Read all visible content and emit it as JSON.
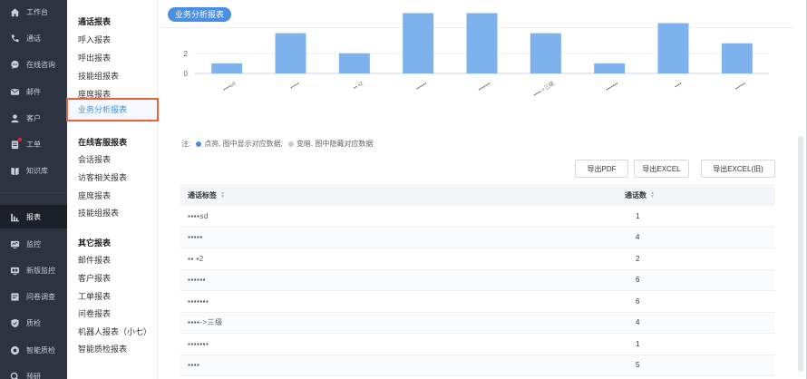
{
  "nav": {
    "items": [
      {
        "label": "工作台",
        "icon": "home-icon"
      },
      {
        "label": "通话",
        "icon": "phone-icon"
      },
      {
        "label": "在线咨询",
        "icon": "chat-icon"
      },
      {
        "label": "邮件",
        "icon": "mail-icon"
      },
      {
        "label": "客户",
        "icon": "user-icon"
      },
      {
        "label": "工单",
        "icon": "ticket-icon"
      },
      {
        "label": "知识库",
        "icon": "book-icon"
      },
      {
        "label": "报表",
        "icon": "report-icon"
      },
      {
        "label": "监控",
        "icon": "monitor-icon"
      },
      {
        "label": "新版监控",
        "icon": "monitor-new-icon"
      },
      {
        "label": "问卷调查",
        "icon": "survey-icon"
      },
      {
        "label": "质检",
        "icon": "shield-icon"
      },
      {
        "label": "智能质检",
        "icon": "smart-check-icon"
      },
      {
        "label": "预研",
        "icon": "research-icon"
      }
    ]
  },
  "submenu": {
    "call_title": "通话报表",
    "call_items": [
      "呼入报表",
      "呼出报表",
      "技能组报表",
      "座席报表",
      "业务分析报表"
    ],
    "online_title": "在线客服报表",
    "online_items": [
      "会话报表",
      "访客相关报表",
      "座席报表",
      "技能组报表"
    ],
    "other_title": "其它报表",
    "other_items": [
      "邮件报表",
      "客户报表",
      "工单报表",
      "问卷报表",
      "机器人报表（小七）",
      "智能质检报表"
    ]
  },
  "page": {
    "tag": "业务分析报表",
    "legend_prefix": "注:",
    "legend_on": "点亮, 图中显示对应数据;",
    "legend_off": "变暗, 图中隐藏对应数据",
    "buttons": {
      "pdf": "导出PDF",
      "excel": "导出EXCEL",
      "excel_old": "导出EXCEL(旧)"
    }
  },
  "chart_data": {
    "type": "bar",
    "categories": [
      "▪▪▪▪sd",
      "▪▪▪▪▪",
      "▪▪ ▪2",
      "▪▪▪▪▪▪",
      "▪▪▪▪▪▪▪",
      "▪▪▪▪->三级",
      "▪▪▪▪▪▪▪",
      "▪▪▪▪",
      "▪▪▪▪▪▪"
    ],
    "values": [
      1,
      4,
      2,
      6,
      6,
      4,
      1,
      5,
      3
    ],
    "yticks": [
      0,
      2
    ],
    "ylim": [
      0,
      5.5
    ],
    "bar_color": "#7eb2ec"
  },
  "table": {
    "col1": "通话标签",
    "col2": "通话数",
    "rows": [
      {
        "label": "▪▪▪▪sd",
        "count": "1"
      },
      {
        "label": "▪▪▪▪▪",
        "count": "4"
      },
      {
        "label": "▪▪ ▪2",
        "count": "2"
      },
      {
        "label": "▪▪▪▪▪▪",
        "count": "6"
      },
      {
        "label": "▪▪▪▪▪▪▪",
        "count": "6"
      },
      {
        "label": "▪▪▪▪->三级",
        "count": "4"
      },
      {
        "label": "▪▪▪▪▪▪▪",
        "count": "1"
      },
      {
        "label": "▪▪▪▪",
        "count": "5"
      }
    ]
  },
  "colors": {
    "accent": "#4a8fe2",
    "nav_bg": "#2d3340",
    "highlight_border": "#e8623d"
  }
}
